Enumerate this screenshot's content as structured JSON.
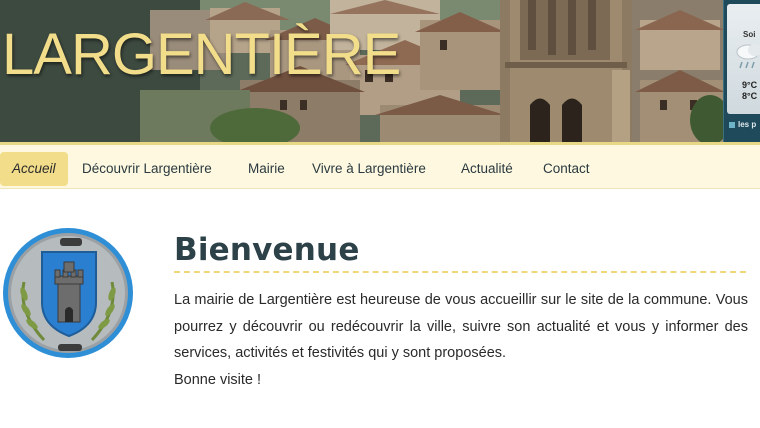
{
  "header": {
    "site_title": "LARGENTIÈRE",
    "colors": {
      "title": "#f2dd8a",
      "nav_background": "#fdf8df",
      "nav_active": "#f2dd8a",
      "heading": "#2d4148"
    }
  },
  "weather": {
    "day_label": "Soi",
    "icon": "rain-cloud-icon",
    "temp_max": "9°C",
    "temp_min": "8°C",
    "link_label": "les p"
  },
  "nav": {
    "items": [
      {
        "label": "Accueil",
        "active": true
      },
      {
        "label": "Découvrir Largentière",
        "active": false
      },
      {
        "label": "Mairie",
        "active": false
      },
      {
        "label": "Vivre à Largentière",
        "active": false
      },
      {
        "label": "Actualité",
        "active": false
      },
      {
        "label": "Contact",
        "active": false
      }
    ]
  },
  "main": {
    "crest_icon": "coat-of-arms-icon",
    "title": "Bienvenue",
    "paragraph_lines": [
      "La mairie de Largentière est heureuse de vous accueillir sur le site de la commune. Vous pourrez y découvrir ou redécouvrir la ville, suivre son actualité et vous y informer des services, activités et festivités qui y sont proposées.",
      "Bonne visite !"
    ]
  }
}
